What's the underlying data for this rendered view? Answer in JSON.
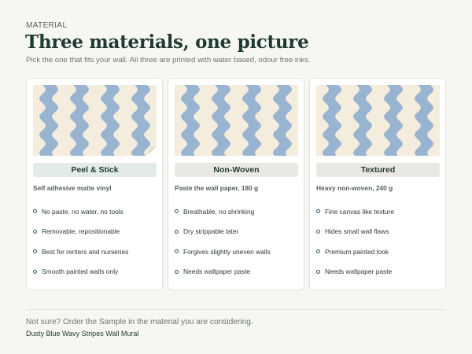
{
  "header": {
    "eyebrow": "MATERIAL",
    "title": "Three materials, one picture",
    "subtitle": "Pick the one that fits your wall. All three are printed with water based, odour free inks."
  },
  "colors": {
    "stripe": "#8fafcf",
    "background_cream": "#f4ecdc",
    "accent_green": "#1f3a30"
  },
  "cards": [
    {
      "name": "Peel & Stick",
      "spec": "Self adhesive matte vinyl",
      "features": [
        "No paste, no water, no tools",
        "Removable, repositionable",
        "Best for renters and nurseries",
        "Smooth painted walls only"
      ]
    },
    {
      "name": "Non-Woven",
      "spec": "Paste the wall paper, 180 g",
      "features": [
        "Breathable, no shrinking",
        "Dry strippable later",
        "Forgives slightly uneven walls",
        "Needs wallpaper paste"
      ]
    },
    {
      "name": "Textured",
      "spec": "Heavy non-woven, 240 g",
      "features": [
        "Fine canvas like texture",
        "Hides small wall flaws",
        "Premium painted look",
        "Needs wallpaper paste"
      ]
    }
  ],
  "footer": {
    "note": "Not sure? Order the Sample in the material you are considering.",
    "product": "Dusty Blue Wavy Stripes Wall Mural"
  }
}
